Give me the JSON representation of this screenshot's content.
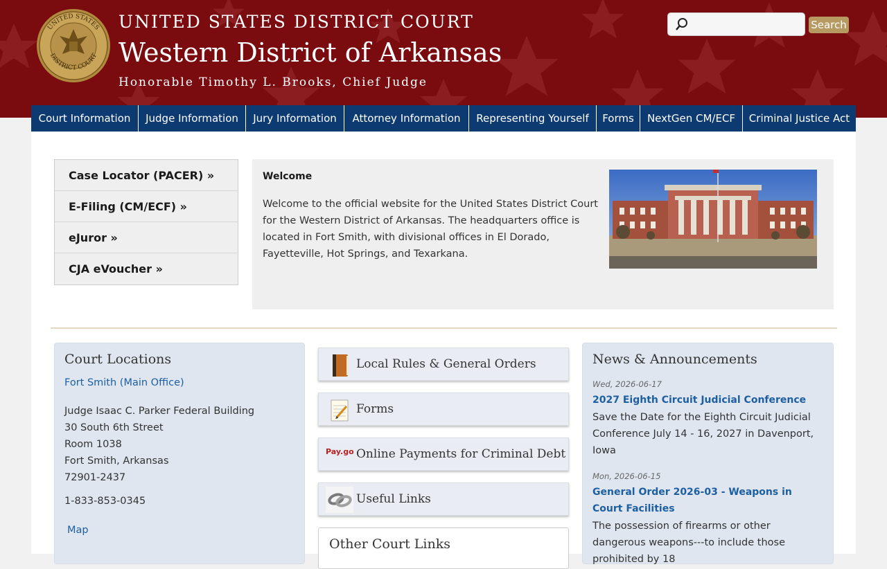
{
  "header": {
    "court_line": "UNITED STATES DISTRICT COURT",
    "district": "Western District of Arkansas",
    "judge": "Honorable Timothy L. Brooks, Chief Judge",
    "seal_top": "UNITED STATES",
    "seal_bottom": "DISTRICT COURT",
    "search_placeholder": "",
    "search_button": "Search"
  },
  "nav": [
    {
      "label": "Court Information"
    },
    {
      "label": "Judge Information"
    },
    {
      "label": "Jury Information"
    },
    {
      "label": "Attorney Information"
    },
    {
      "label": "Representing Yourself"
    },
    {
      "label": "Forms"
    },
    {
      "label": "NextGen CM/ECF"
    },
    {
      "label": "Criminal Justice Act"
    }
  ],
  "quick_links": [
    {
      "label": "Case Locator (PACER) »"
    },
    {
      "label": "E-Filing (CM/ECF) »"
    },
    {
      "label": "eJuror »"
    },
    {
      "label": "CJA eVoucher »"
    }
  ],
  "welcome": {
    "heading": "Welcome",
    "text": "Welcome to the official website for the United States District Court for the Western District of Arkansas. The headquarters office is located in Fort Smith, with divisional offices in El Dorado, Fayetteville, Hot Springs, and Texarkana."
  },
  "locations": {
    "title": "Court Locations",
    "office": "Fort Smith (Main Office)",
    "address": [
      "Judge Isaac C. Parker Federal Building",
      "30 South 6th Street",
      "Room 1038",
      "Fort Smith, Arkansas",
      "72901-2437"
    ],
    "phone": "1-833-853-0345",
    "map": "Map"
  },
  "tiles": [
    {
      "label": "Local Rules & General Orders",
      "icon": "book-icon"
    },
    {
      "label": "Forms",
      "icon": "notepad-icon"
    },
    {
      "label": "Online Payments for Criminal Debt",
      "icon": "paygov-logo",
      "logo_text": "Pay.gov"
    },
    {
      "label": "Useful Links",
      "icon": "chain-link-icon"
    }
  ],
  "other": {
    "title": "Other Court Links"
  },
  "news": {
    "title": "News & Announcements",
    "items": [
      {
        "date": "Wed, 2026-06-17",
        "headline": "2027 Eighth Circuit Judicial Conference",
        "body": "Save the Date for the Eighth Circuit Judicial Conference July 14 - 16, 2027 in Davenport, Iowa"
      },
      {
        "date": "Mon, 2026-06-15",
        "headline": "General Order 2026-03 - Weapons in Court Facilities",
        "body": "The possession of firearms or other dangerous weapons---to include those prohibited by 18"
      }
    ]
  },
  "colors": {
    "header_bg": "#7a0c10",
    "nav_bg": "#0d3a70",
    "link": "#1d5fa1",
    "search_button": "#b79a61"
  }
}
